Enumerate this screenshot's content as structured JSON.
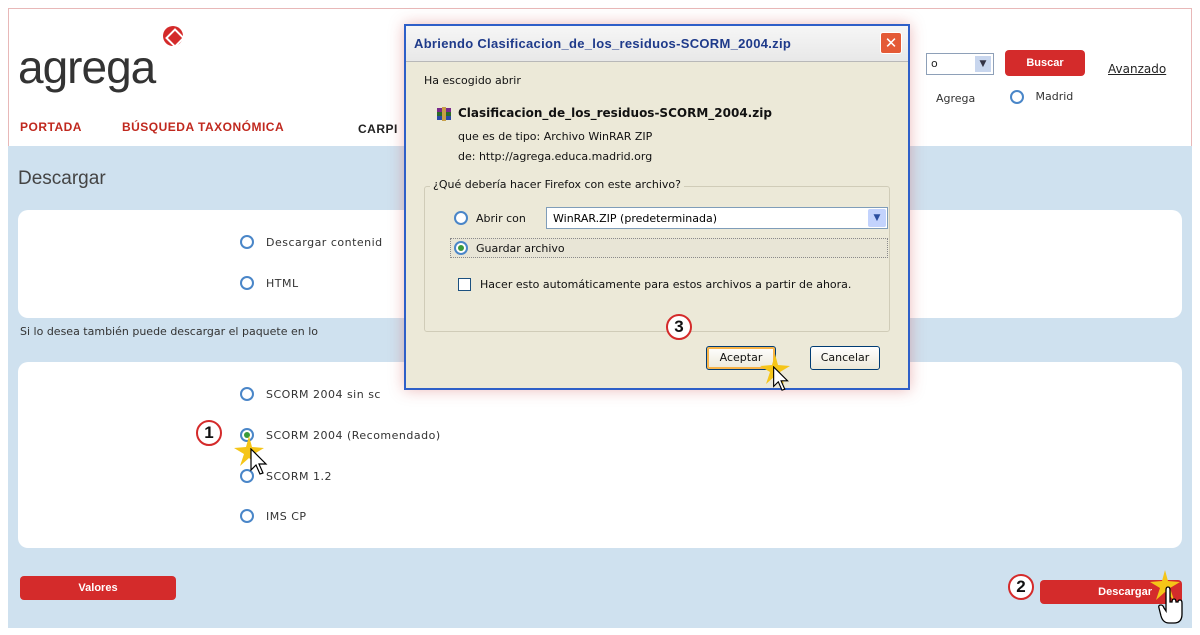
{
  "header": {
    "logo_text": "agrega",
    "search_select_value": "o",
    "search_button": "Buscar",
    "advanced_link": "Avanzado",
    "scope_agrega": "Agrega",
    "scope_madrid": "Madrid"
  },
  "nav": {
    "portada": "PORTADA",
    "taxonomica": "BÚSQUEDA TAXONÓMICA",
    "carpeta": "CARPI"
  },
  "page": {
    "title": "Descargar",
    "option_contenido": "Descargar contenid",
    "option_html": "HTML",
    "note": "Si lo desea también puede descargar el paquete en lo",
    "option_scorm2004_sin": "SCORM 2004 sin sc",
    "option_scorm2004_rec": "SCORM 2004 (Recomendado)",
    "option_scorm12": "SCORM 1.2",
    "option_imscp": "IMS CP",
    "values_button": "Valores",
    "download_button": "Descargar"
  },
  "steps": {
    "one": "1",
    "two": "2",
    "three": "3"
  },
  "dialog": {
    "title": "Abriendo Clasificacion_de_los_residuos-SCORM_2004.zip",
    "intro": "Ha escogido abrir",
    "filename": "Clasificacion_de_los_residuos-SCORM_2004.zip",
    "type_line": "que es de tipo:  Archivo WinRAR ZIP",
    "from_line": "de:  http://agrega.educa.madrid.org",
    "question": "¿Qué debería hacer Firefox con este archivo?",
    "open_with_label": "Abrir con",
    "open_with_value": "WinRAR.ZIP (predeterminada)",
    "save_label": "Guardar archivo",
    "auto_label": "Hacer esto automáticamente para estos archivos a partir de ahora.",
    "ok_button": "Aceptar",
    "cancel_button": "Cancelar",
    "close_glyph": "✕"
  },
  "colors": {
    "brand_red": "#d42b2b",
    "panel_blue": "#cfe1ef",
    "dialog_border": "#2e5fc8"
  }
}
